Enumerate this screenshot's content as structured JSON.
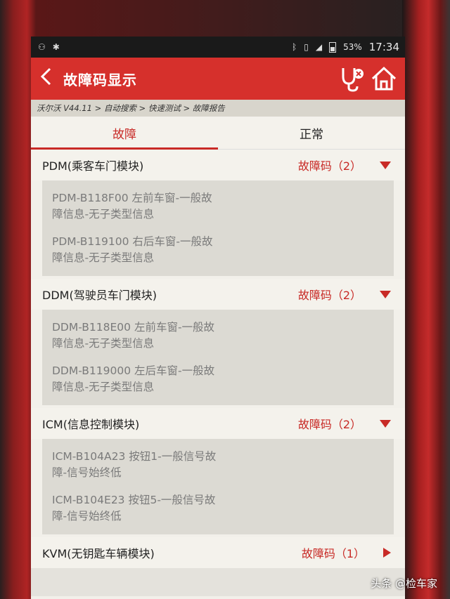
{
  "status_bar": {
    "battery": "53%",
    "time": "17:34"
  },
  "header": {
    "back_icon": "chevron-left-icon",
    "title": "故障码显示",
    "stethoscope_icon": "stethoscope-icon",
    "home_icon": "home-icon"
  },
  "breadcrumb": "沃尔沃 V44.11 > 自动搜索 > 快速测试 > 故障报告",
  "tabs": [
    {
      "label": "故障",
      "active": true
    },
    {
      "label": "正常",
      "active": false
    }
  ],
  "groups": [
    {
      "name": "PDM(乘客车门模块)",
      "count_label": "故障码（2）",
      "expanded": true,
      "codes": [
        "PDM-B118F00 左前车窗-一般故障信息-无子类型信息",
        "PDM-B119100 右后车窗-一般故障信息-无子类型信息"
      ]
    },
    {
      "name": "DDM(驾驶员车门模块)",
      "count_label": "故障码（2）",
      "expanded": true,
      "codes": [
        "DDM-B118E00  左前车窗-一般故障信息-无子类型信息",
        "DDM-B119000  左后车窗-一般故障信息-无子类型信息"
      ]
    },
    {
      "name": "ICM(信息控制模块)",
      "count_label": "故障码（2）",
      "expanded": true,
      "codes": [
        "ICM-B104A23 按钮1-一般信号故障-信号始终低",
        "ICM-B104E23 按钮5-一般信号故障-信号始终低"
      ]
    },
    {
      "name": "KVM(无钥匙车辆模块)",
      "count_label": "故障码（1）",
      "expanded": false,
      "codes": []
    }
  ],
  "watermark": "头条 @检车家",
  "colors": {
    "accent": "#d6302c",
    "code_text": "#7a7a7a"
  }
}
